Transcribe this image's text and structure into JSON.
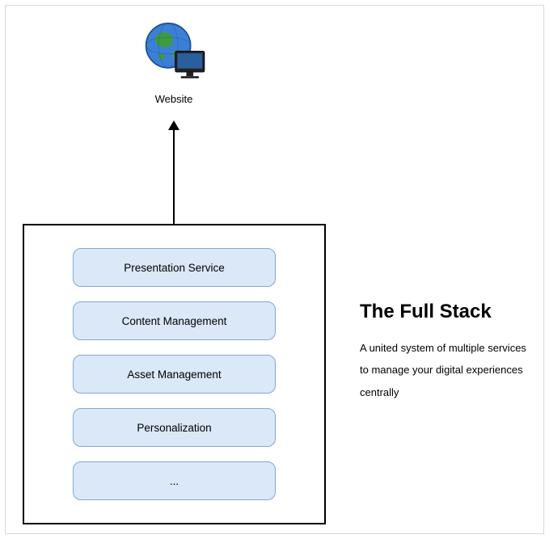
{
  "globe": {
    "label": "Website"
  },
  "stack": {
    "layers": [
      {
        "label": "Presentation Service"
      },
      {
        "label": "Content Management"
      },
      {
        "label": "Asset Management"
      },
      {
        "label": "Personalization"
      },
      {
        "label": "..."
      }
    ]
  },
  "side": {
    "title": "The Full Stack",
    "description": "A united system of multiple services to manage your digital experiences centrally"
  },
  "colors": {
    "layer_fill": "#dbe8f7",
    "layer_border": "#7fa8d9",
    "canvas_border": "#d9d9d9"
  }
}
